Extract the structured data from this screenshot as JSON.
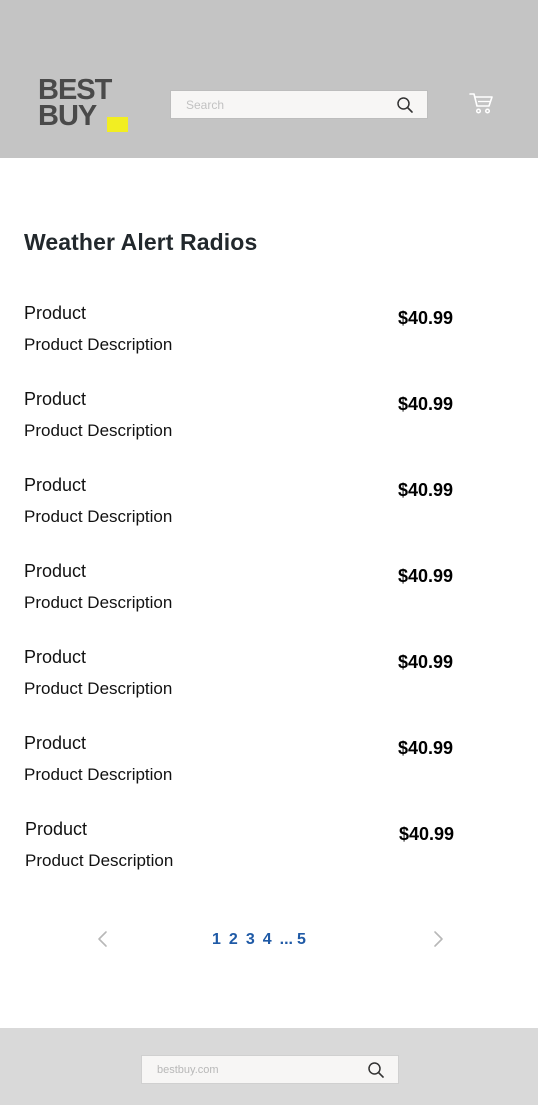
{
  "header": {
    "logo": {
      "line1": "BEST",
      "line2": "BUY"
    },
    "search": {
      "placeholder": "Search",
      "value": ""
    },
    "search_icon": "search-icon",
    "cart_icon": "cart-icon"
  },
  "main": {
    "title": "Weather Alert Radios",
    "products": [
      {
        "name": "Product",
        "description": "Product Description",
        "price": "$40.99"
      },
      {
        "name": "Product",
        "description": "Product Description",
        "price": "$40.99"
      },
      {
        "name": "Product",
        "description": "Product Description",
        "price": "$40.99"
      },
      {
        "name": "Product",
        "description": "Product Description",
        "price": "$40.99"
      },
      {
        "name": "Product",
        "description": "Product Description",
        "price": "$40.99"
      },
      {
        "name": "Product",
        "description": "Product Description",
        "price": "$40.99"
      },
      {
        "name": "Product",
        "description": "Product Description",
        "price": "$40.99"
      }
    ]
  },
  "pagination": {
    "prev_icon": "chevron-left-icon",
    "next_icon": "chevron-right-icon",
    "pages": [
      "1",
      "2",
      "3",
      "4"
    ],
    "ellipsis": "...",
    "last": "5"
  },
  "footer": {
    "url": "bestbuy.com",
    "search_icon": "search-icon"
  },
  "colors": {
    "header_bg": "#c4c4c4",
    "footer_bg": "#d9d9d9",
    "logo_tag": "#f2ee22",
    "pagination_link": "#1f5aa6"
  }
}
